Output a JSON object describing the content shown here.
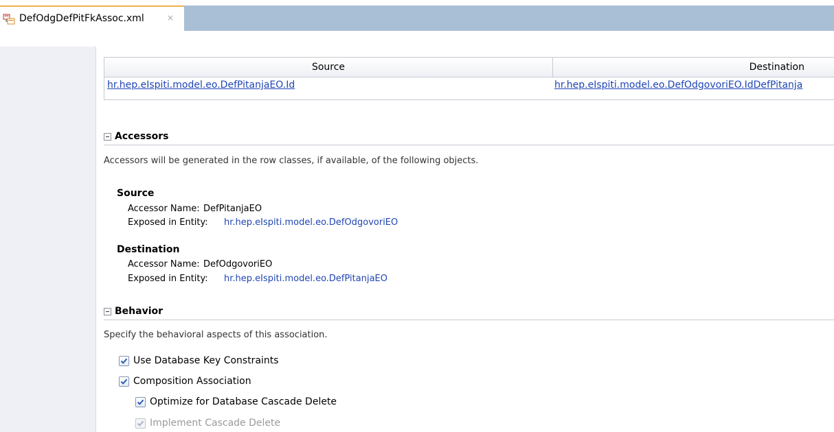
{
  "tab": {
    "title": "DefOdgDefPitFkAssoc.xml",
    "close": "×",
    "icon": "xml-file-icon"
  },
  "table": {
    "headers": {
      "source": "Source",
      "destination": "Destination"
    },
    "row": {
      "source": "hr.hep.eIspiti.model.eo.DefPitanjaEO.Id",
      "destination": "hr.hep.eIspiti.model.eo.DefOdgovoriEO.IdDefPitanja"
    }
  },
  "accessors": {
    "title": "Accessors",
    "description": "Accessors will be generated in the row classes, if available, of the following objects.",
    "source": {
      "title": "Source",
      "name_label": "Accessor Name:",
      "name_value": "DefPitanjaEO",
      "entity_label": "Exposed in Entity:",
      "entity_value": "hr.hep.eIspiti.model.eo.DefOdgovoriEO"
    },
    "destination": {
      "title": "Destination",
      "name_label": "Accessor Name:",
      "name_value": "DefOdgovoriEO",
      "entity_label": "Exposed in Entity:",
      "entity_value": "hr.hep.eIspiti.model.eo.DefPitanjaEO"
    }
  },
  "behavior": {
    "title": "Behavior",
    "description": "Specify the behavioral aspects of this association.",
    "options": [
      {
        "label": "Use Database Key Constraints",
        "checked": true,
        "enabled": true
      },
      {
        "label": "Composition Association",
        "checked": true,
        "enabled": true
      },
      {
        "label": "Optimize for Database Cascade Delete",
        "checked": true,
        "enabled": true
      },
      {
        "label": "Implement Cascade Delete",
        "checked": true,
        "enabled": false
      }
    ]
  },
  "colors": {
    "link": "#1f45b4",
    "tabbar": "#a9bfd6",
    "tab_accent": "#f0b050",
    "check": "#2a5db0"
  }
}
